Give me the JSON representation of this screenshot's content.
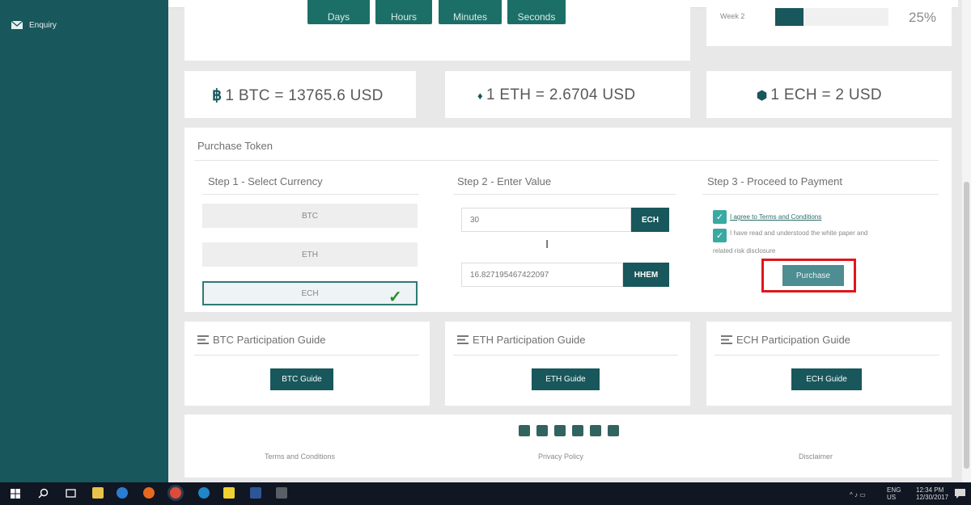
{
  "sidebar": {
    "items": [
      {
        "label": "Enquiry",
        "icon": "envelope-icon"
      }
    ]
  },
  "countdown": {
    "buttons": [
      "Days",
      "Hours",
      "Minutes",
      "Seconds"
    ],
    "week_label": "Week 2",
    "week_progress_percent": 25,
    "week_percent_text": "25%"
  },
  "rates": {
    "btc": {
      "symbol": "฿",
      "text": "1 BTC = 13765.6 USD"
    },
    "eth": {
      "symbol": "♦",
      "text": "1 ETH = 2.6704 USD"
    },
    "ech": {
      "symbol": "⬢",
      "text": "1 ECH = 2 USD"
    }
  },
  "purchase": {
    "title": "Purchase Token",
    "step1": {
      "title": "Step 1 - Select Currency",
      "options": [
        "BTC",
        "ETH",
        "ECH"
      ],
      "selected": "ECH"
    },
    "step2": {
      "title": "Step 2 - Enter Value",
      "amount_value": "30",
      "amount_unit": "ECH",
      "converted_value": "16.827195467422097",
      "converted_unit": "HHEM"
    },
    "step3": {
      "title": "Step 3 - Proceed to Payment",
      "terms_label": "I agree to Terms and Conditions",
      "paper_label_line1": "I have read and understood the white paper and",
      "paper_label_line2": "related risk disclosure",
      "purchase_button": "Purchase"
    }
  },
  "guides": [
    {
      "title": "BTC Participation Guide",
      "button": "BTC Guide"
    },
    {
      "title": "ETH Participation Guide",
      "button": "ETH Guide"
    },
    {
      "title": "ECH Participation Guide",
      "button": "ECH Guide"
    }
  ],
  "footer": {
    "social_icons": [
      "facebook-icon",
      "twitter-icon",
      "linkedin-icon",
      "medium-icon",
      "telegram-icon",
      "youtube-icon"
    ],
    "links": [
      "Terms and Conditions",
      "Privacy Policy",
      "Disclaimer"
    ]
  },
  "taskbar": {
    "lang_line1": "ENG",
    "lang_line2": "US",
    "time": "12:34 PM",
    "date": "12/30/2017"
  },
  "colors": {
    "brand": "#18575c",
    "accent": "#1c6f67",
    "highlight": "#e0161b"
  }
}
